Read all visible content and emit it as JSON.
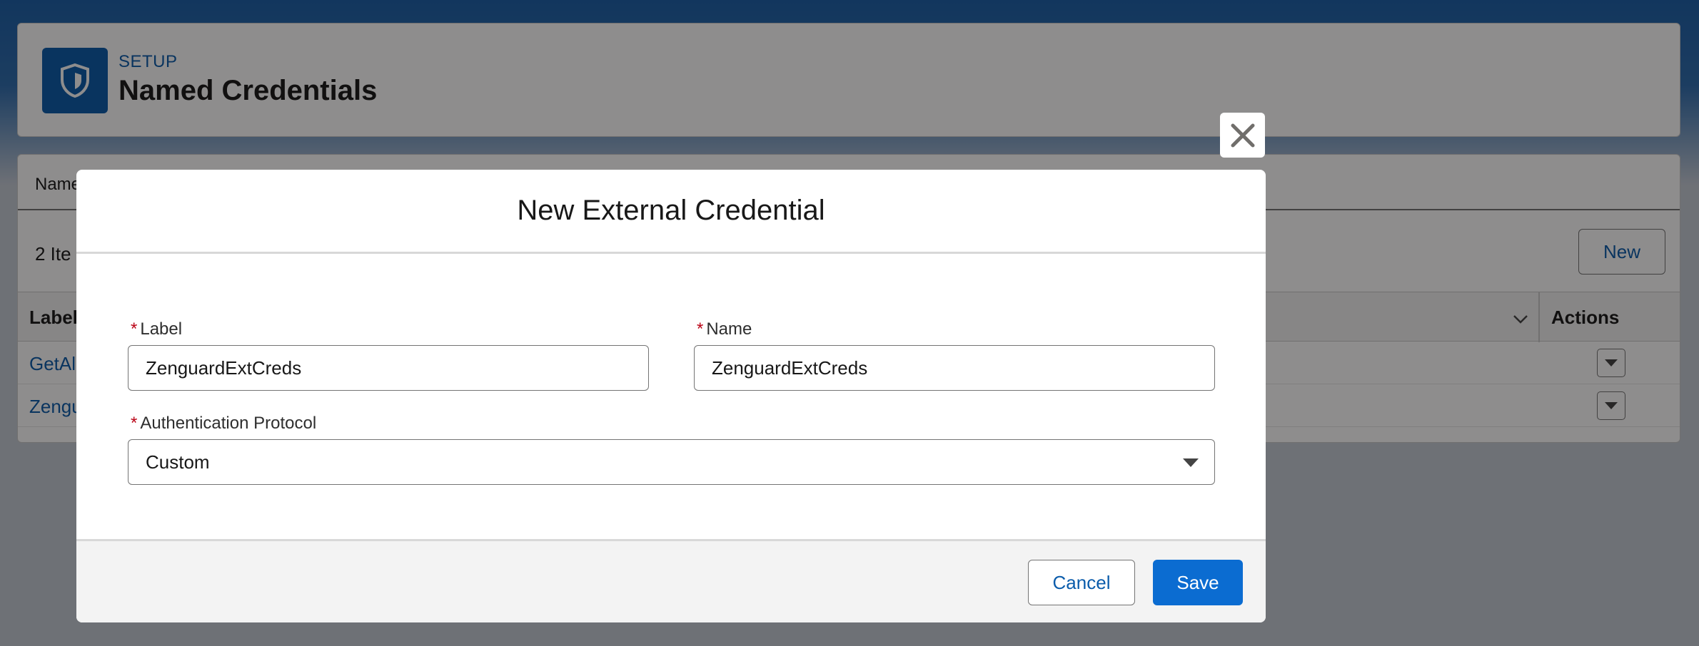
{
  "setup_header": {
    "eyebrow": "SETUP",
    "title": "Named Credentials"
  },
  "list": {
    "tab_label": "Name",
    "items_count": "2 Ite",
    "new_label": "New",
    "columns": {
      "label": "Label",
      "actions": "Actions"
    },
    "rows": [
      {
        "label": "GetAl"
      },
      {
        "label": "Zengu"
      }
    ]
  },
  "modal": {
    "title": "New External Credential",
    "fields": {
      "label": {
        "label": "Label",
        "required_mark": "*",
        "value": "ZenguardExtCreds"
      },
      "name": {
        "label": "Name",
        "required_mark": "*",
        "value": "ZenguardExtCreds"
      },
      "auth_protocol": {
        "label": "Authentication Protocol",
        "required_mark": "*",
        "value": "Custom"
      }
    },
    "footer": {
      "cancel_label": "Cancel",
      "save_label": "Save"
    }
  },
  "colors": {
    "brand_blue": "#0b5cab",
    "save_button": "#0b6cd1",
    "required": "#ba0517"
  },
  "icons": [
    "shield-icon",
    "close-icon",
    "chevron-down-icon",
    "dropdown-arrow-icon"
  ]
}
